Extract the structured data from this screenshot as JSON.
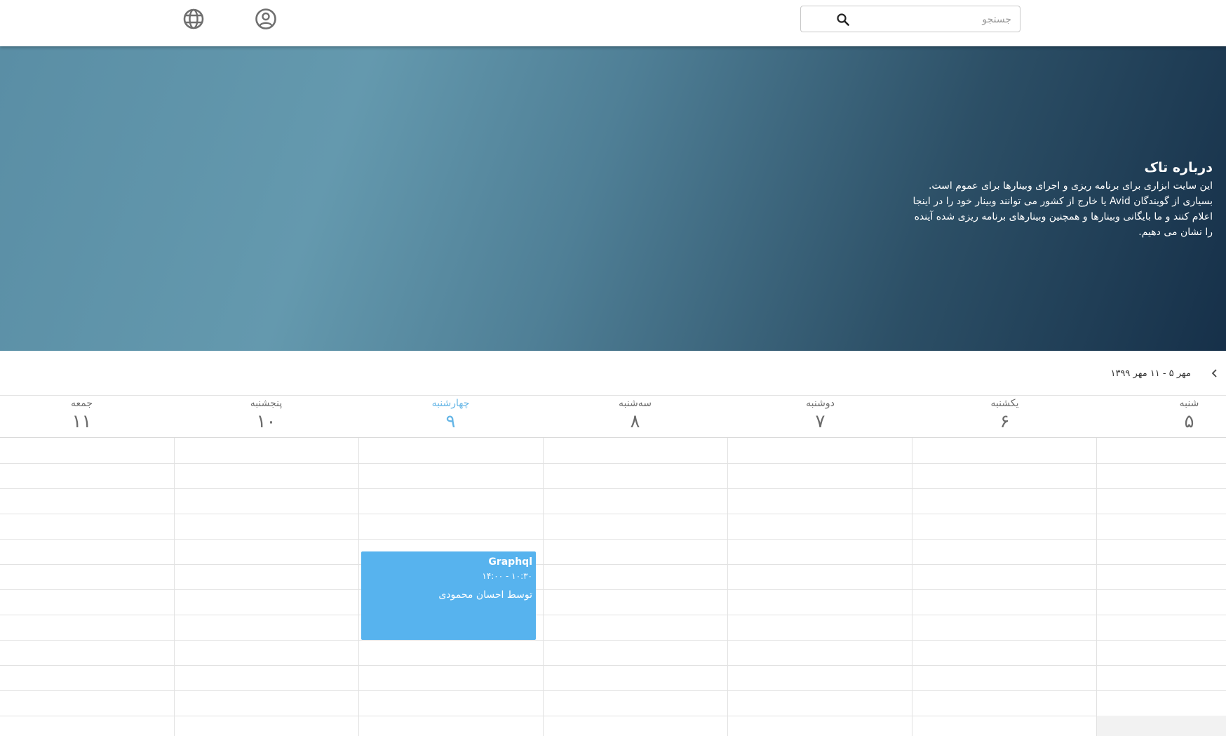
{
  "header": {
    "search": {
      "placeholder": "جستجو",
      "value": ""
    },
    "icons": {
      "language": "globe-icon",
      "account": "user-circle-icon",
      "search": "search-icon"
    }
  },
  "hero": {
    "title": "درباره تاک",
    "lines": [
      "این سایت ابزاری برای برنامه ریزی و اجرای وبینارها برای عموم است.",
      "بسیاری از گویندگان Avid یا خارج از کشور می توانند وبینار خود را در اینجا",
      "اعلام کنند و ما بایگانی وبینارها و همچنین وبینارهای برنامه ریزی شده آینده",
      "را نشان می دهیم."
    ]
  },
  "calendar": {
    "range_label": "مهر ۵ - ۱۱ مهر ۱۳۹۹",
    "days": [
      {
        "name": "شنبه",
        "num": "۵"
      },
      {
        "name": "یکشنبه",
        "num": "۶"
      },
      {
        "name": "دوشنبه",
        "num": "۷"
      },
      {
        "name": "سه‌شنبه",
        "num": "۸"
      },
      {
        "name": "چهارشنبه",
        "num": "۹"
      },
      {
        "name": "پنجشنبه",
        "num": "۱۰"
      },
      {
        "name": "جمعه",
        "num": "۱۱"
      }
    ],
    "today_index": 4,
    "event": {
      "title": "Graphql",
      "time": "۱۰:۳۰  -  ۱۴:۰۰",
      "speaker": "توسط احسان محمودی"
    }
  },
  "colors": {
    "accent": "#57b3ee",
    "today": "#64b5e6",
    "hero_start": "#6499ae",
    "hero_end": "#163049"
  }
}
